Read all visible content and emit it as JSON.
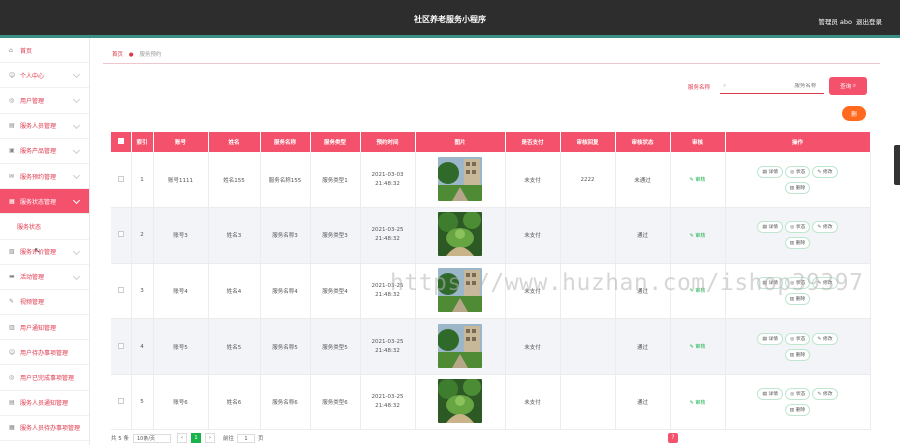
{
  "header": {
    "title": "社区养老服务小程序",
    "user": "管理员 abo",
    "logout": "退出登录"
  },
  "sidebar": {
    "items": [
      {
        "label": "首页",
        "icon": "home-icon",
        "glyph": "⌂"
      },
      {
        "label": "个人中心",
        "icon": "user-icon",
        "glyph": "☺"
      },
      {
        "label": "用户管理",
        "icon": "users-icon",
        "glyph": "◎"
      },
      {
        "label": "服务人员管理",
        "icon": "staff-icon",
        "glyph": "▤"
      },
      {
        "label": "服务产品管理",
        "icon": "product-icon",
        "glyph": "▣"
      },
      {
        "label": "服务预约管理",
        "icon": "booking-icon",
        "glyph": "✉"
      },
      {
        "label": "服务状态管理",
        "icon": "status-icon",
        "glyph": "▦"
      },
      {
        "label": "服务状态",
        "icon": "",
        "glyph": ""
      },
      {
        "label": "服务评价管理",
        "icon": "review-icon",
        "glyph": "▧"
      },
      {
        "label": "活动管理",
        "icon": "activity-icon",
        "glyph": "▬"
      },
      {
        "label": "视频管理",
        "icon": "video-icon",
        "glyph": "✎"
      },
      {
        "label": "用户通知管理",
        "icon": "notice-icon",
        "glyph": "▥"
      },
      {
        "label": "用户待办事项管理",
        "icon": "todo-icon",
        "glyph": "☺"
      },
      {
        "label": "用户已完成事项管理",
        "icon": "done-icon",
        "glyph": "◎"
      },
      {
        "label": "服务人员通知管理",
        "icon": "staff-notice-icon",
        "glyph": "▤"
      },
      {
        "label": "服务人员待办事项管理",
        "icon": "staff-todo-icon",
        "glyph": "▦"
      }
    ]
  },
  "breadcrumb": {
    "home": "首页",
    "current": "服务预约"
  },
  "search": {
    "label": "服务名称",
    "placeholder": "服务名称",
    "button": "查询"
  },
  "delete_button": "删",
  "table": {
    "headers": [
      "",
      "索引",
      "账号",
      "姓名",
      "服务名称",
      "服务类型",
      "预约时间",
      "图片",
      "是否支付",
      "审核回复",
      "审核状态",
      "审核",
      "操作"
    ],
    "rows": [
      {
        "index": "1",
        "account": "账号1111",
        "name": "姓名155",
        "service": "服务名称155",
        "type": "服务类型1",
        "time": "2021-03-03 21:48:32",
        "paid": "未支付",
        "reply": "2222",
        "status": "未通过",
        "review": "审核"
      },
      {
        "index": "2",
        "account": "账号3",
        "name": "姓名3",
        "service": "服务名称3",
        "type": "服务类型3",
        "time": "2021-03-25 21:48:32",
        "paid": "未支付",
        "reply": "",
        "status": "通过",
        "review": "审核"
      },
      {
        "index": "3",
        "account": "账号4",
        "name": "姓名4",
        "service": "服务名称4",
        "type": "服务类型4",
        "time": "2021-03-25 21:48:32",
        "paid": "未支付",
        "reply": "",
        "status": "通过",
        "review": "审核"
      },
      {
        "index": "4",
        "account": "账号5",
        "name": "姓名5",
        "service": "服务名称5",
        "type": "服务类型5",
        "time": "2021-03-25 21:48:32",
        "paid": "未支付",
        "reply": "",
        "status": "通过",
        "review": "审核"
      },
      {
        "index": "5",
        "account": "账号6",
        "name": "姓名6",
        "service": "服务名称6",
        "type": "服务类型6",
        "time": "2021-03-25 21:48:32",
        "paid": "未支付",
        "reply": "",
        "status": "通过",
        "review": "审核"
      }
    ],
    "actions": {
      "detail": "详情",
      "status": "状态",
      "edit": "修改",
      "delete": "删除"
    }
  },
  "pagination": {
    "total": "共 5 条",
    "per_page": "10条/页",
    "page": "1",
    "goto": "前往",
    "goto_value": "1",
    "page_suffix": "页"
  },
  "watermark": "https://www.huzhan.com/ishop39397",
  "colors": {
    "accent": "#f4516c",
    "header_bg": "#2d2d2d",
    "success": "#19b24b"
  }
}
